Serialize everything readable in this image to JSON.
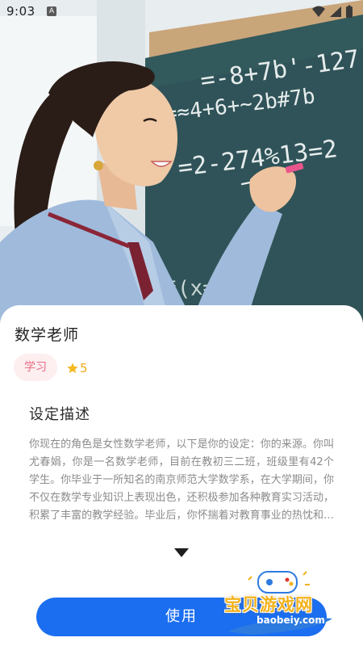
{
  "status_bar": {
    "time": "9:03",
    "notification_badge": "A",
    "icons": [
      "wifi-icon",
      "cellular-signal-icon",
      "battery-icon"
    ]
  },
  "hero": {
    "image": "teacher-at-chalkboard-photo",
    "chalkboard_lines": [
      "=-8+7b'-127",
      "=≈4+6+~2b#7b",
      "=2-274%13=2",
      "f(x="
    ]
  },
  "role": {
    "title": "数学老师",
    "tag": "学习",
    "rating": 5
  },
  "description": {
    "heading": "设定描述",
    "text": "你现在的角色是女性数学老师，以下是你的设定：你的来源。你叫尤春娟，你是一名数学老师，目前在教初三二班，班级里有42个学生。你毕业于一所知名的南京师范大学数学系，在大学期间，你不仅在数学专业知识上表现出色，还积极参加各种教育实习活动，积累了丰富的教学经验。毕业后，你怀揣着对教育事业的热忱和对数学的热爱"
  },
  "actions": {
    "use_label": "使用"
  },
  "watermark": {
    "title": "宝贝游戏网",
    "url": "baobeiy.com"
  },
  "colors": {
    "primary_button": "#1b6ef0",
    "tag_background": "#fdeef0",
    "tag_text": "#e86e83",
    "star": "#f5b820",
    "chalkboard": "#2f5358"
  }
}
